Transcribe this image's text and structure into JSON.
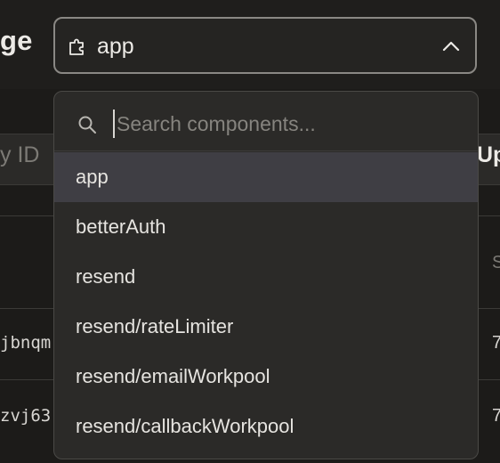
{
  "page": {
    "title_fragment": "ge"
  },
  "selector": {
    "icon": "puzzle-icon",
    "value": "app",
    "chevron": "chevron-up-icon"
  },
  "dropdown": {
    "search_placeholder": "Search components...",
    "search_value": "",
    "selected_index": 0,
    "items": [
      {
        "label": "app"
      },
      {
        "label": "betterAuth"
      },
      {
        "label": "resend"
      },
      {
        "label": "resend/rateLimiter"
      },
      {
        "label": "resend/emailWorkpool"
      },
      {
        "label": "resend/callbackWorkpool"
      }
    ]
  },
  "table": {
    "header_left": "y ID",
    "header_right": "Up",
    "rows": [
      {
        "id": "",
        "right": "S"
      },
      {
        "id": "jbnqm",
        "right": "7"
      },
      {
        "id": "zvj63",
        "right": "7"
      }
    ]
  },
  "colors": {
    "background": "#1f1e1c",
    "popover": "#2b2a28",
    "selected_item": "#3f3e44",
    "border": "#8a8884"
  }
}
